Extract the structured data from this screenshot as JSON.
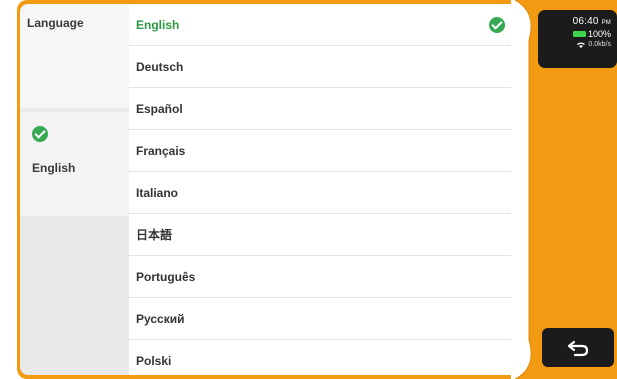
{
  "left_panel": {
    "title": "Language",
    "current_language": "English"
  },
  "languages": [
    {
      "label": "English",
      "selected": true
    },
    {
      "label": "Deutsch",
      "selected": false
    },
    {
      "label": "Español",
      "selected": false
    },
    {
      "label": "Français",
      "selected": false
    },
    {
      "label": "Italiano",
      "selected": false
    },
    {
      "label": "日本語",
      "selected": false
    },
    {
      "label": "Português",
      "selected": false
    },
    {
      "label": "Русский",
      "selected": false
    },
    {
      "label": "Polski",
      "selected": false
    }
  ],
  "status": {
    "time": "06:40",
    "ampm": "PM",
    "battery": "100%",
    "network": "0.0kb/s"
  },
  "colors": {
    "accent": "#f29a12",
    "selected_text": "#2e9a43",
    "check": "#37a853"
  },
  "icons": {
    "check": "check-circle-icon",
    "back": "back-arrow-icon",
    "battery": "battery-icon",
    "wifi": "wifi-icon"
  }
}
